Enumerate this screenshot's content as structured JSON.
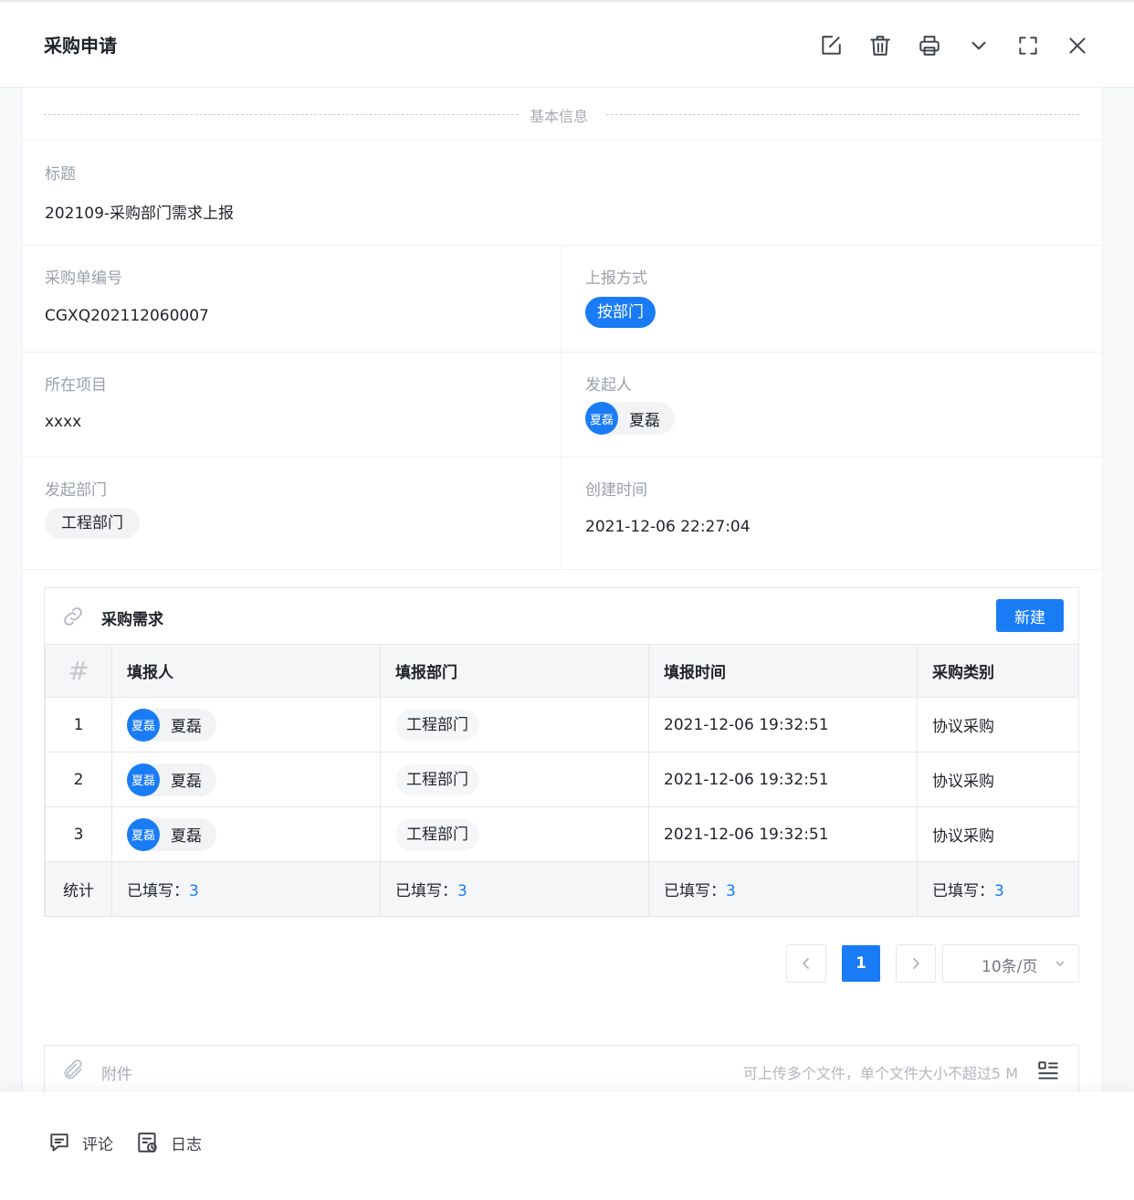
{
  "header": {
    "title": "采购申请",
    "icons": [
      "edit-icon",
      "trash-icon",
      "printer-icon",
      "chevron-down-icon",
      "fullscreen-icon",
      "close-icon"
    ]
  },
  "section": {
    "basic_info": "基本信息"
  },
  "fields": {
    "title": {
      "label": "标题",
      "value": "202109-采购部门需求上报"
    },
    "order_no": {
      "label": "采购单编号",
      "value": "CGXQ202112060007"
    },
    "report_method": {
      "label": "上报方式",
      "value": "按部门"
    },
    "project": {
      "label": "所在项目",
      "value": "xxxx"
    },
    "initiator": {
      "label": "发起人",
      "avatar_text": "夏磊",
      "name": "夏磊"
    },
    "department": {
      "label": "发起部门",
      "value": "工程部门"
    },
    "created_at": {
      "label": "创建时间",
      "value": "2021-12-06 22:27:04"
    }
  },
  "subtable": {
    "title": "采购需求",
    "new_button": "新建",
    "columns": [
      "#",
      "填报人",
      "填报部门",
      "填报时间",
      "采购类别"
    ],
    "rows": [
      {
        "index": "1",
        "avatar_text": "夏磊",
        "name": "夏磊",
        "dept": "工程部门",
        "time": "2021-12-06 19:32:51",
        "category": "协议采购"
      },
      {
        "index": "2",
        "avatar_text": "夏磊",
        "name": "夏磊",
        "dept": "工程部门",
        "time": "2021-12-06 19:32:51",
        "category": "协议采购"
      },
      {
        "index": "3",
        "avatar_text": "夏磊",
        "name": "夏磊",
        "dept": "工程部门",
        "time": "2021-12-06 19:32:51",
        "category": "协议采购"
      }
    ],
    "stat": {
      "label": "统计",
      "filled_label": "已填写：",
      "filled_counts": [
        "3",
        "3",
        "3",
        "3"
      ]
    }
  },
  "pagination": {
    "current_page": "1",
    "page_size": "10条/页"
  },
  "attachment": {
    "label": "附件",
    "hint": "可上传多个文件，单个文件大小不超过5 M"
  },
  "footer": {
    "comment": "评论",
    "log": "日志"
  },
  "colors": {
    "accent": "#1a7cf5",
    "border": "#e5e7ea",
    "muted_text": "#9aa0a8"
  }
}
